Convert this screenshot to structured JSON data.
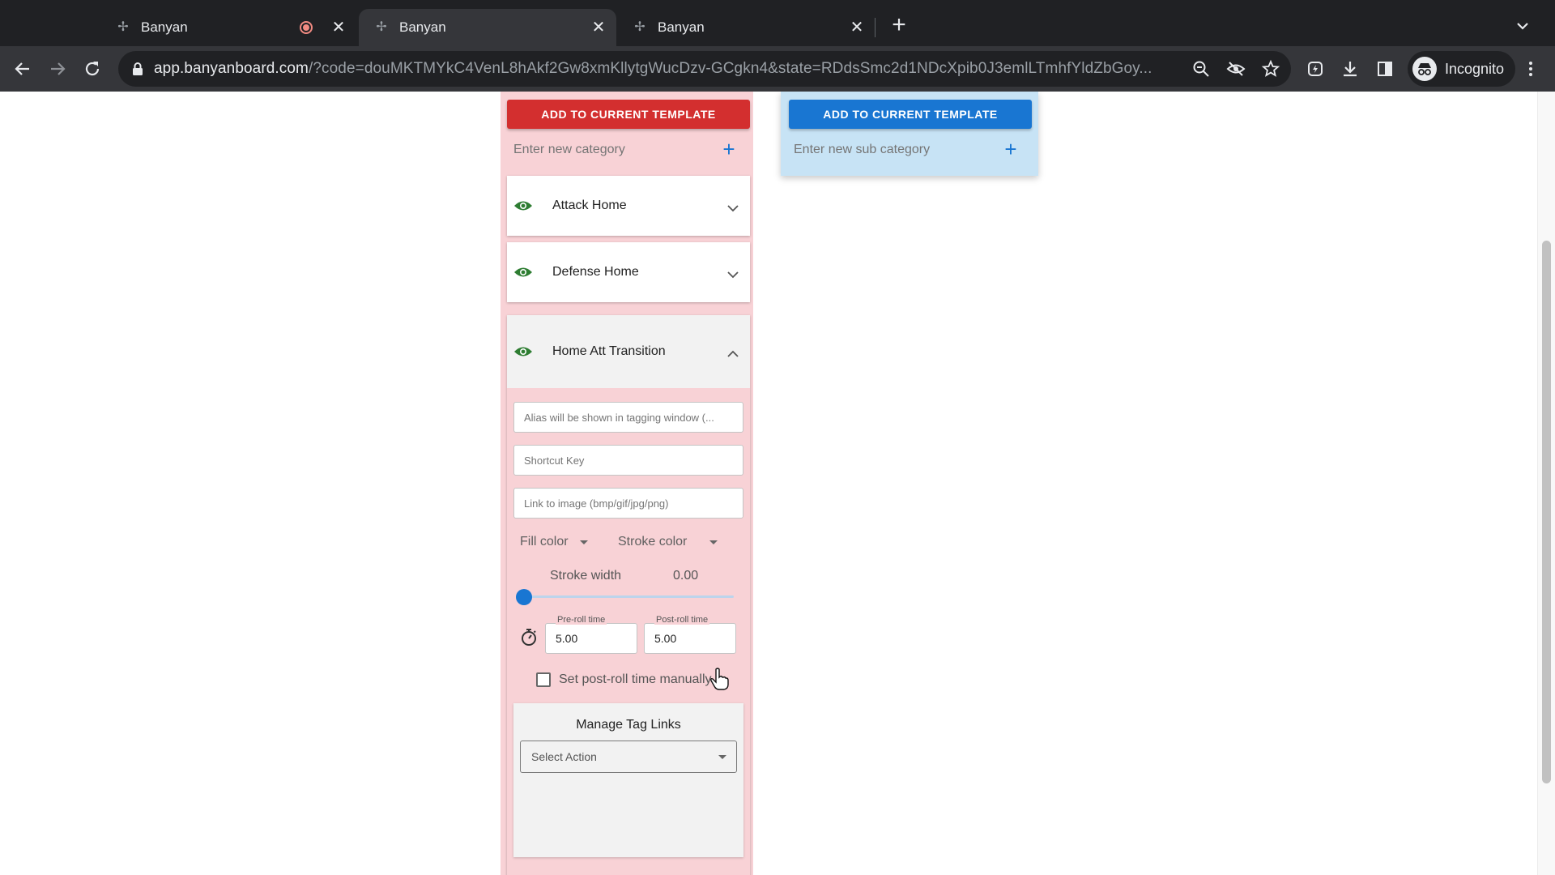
{
  "browser": {
    "tabs": [
      {
        "title": "Banyan",
        "recording": true,
        "active": false
      },
      {
        "title": "Banyan",
        "recording": false,
        "active": true
      },
      {
        "title": "Banyan",
        "recording": false,
        "active": false
      }
    ],
    "url_host": "app.banyanboard.com",
    "url_path": "/?code=douMKTMYkC4VenL8hAkf2Gw8xmKllytgWucDzv-GCgkn4&state=RDdsSmc2d1NDcXpib0J3emlLTmhfYldZbGoy...",
    "profile_label": "Incognito",
    "colors": {
      "tabstrip": "#202124",
      "toolbar": "#35363a",
      "omnibox": "#202124"
    }
  },
  "category_panel": {
    "add_button": "ADD TO CURRENT TEMPLATE",
    "new_placeholder": "Enter new category",
    "accent_color": "#d32f2f",
    "background": "#f8d2d6",
    "categories": [
      {
        "name": "Attack Home",
        "expanded": false
      },
      {
        "name": "Defense Home",
        "expanded": false
      },
      {
        "name": "Home Att Transition",
        "expanded": true
      }
    ],
    "editor": {
      "alias_placeholder": "Alias will be shown in tagging window (...",
      "shortcut_placeholder": "Shortcut Key",
      "image_link_placeholder": "Link to image (bmp/gif/jpg/png)",
      "fill_color_label": "Fill color",
      "stroke_color_label": "Stroke color",
      "stroke_width_label": "Stroke width",
      "stroke_width_value": "0.00",
      "stroke_width_fraction": 0,
      "pre_roll_label": "Pre-roll time",
      "pre_roll_value": "5.00",
      "post_roll_label": "Post-roll time",
      "post_roll_value": "5.00",
      "manual_post_roll_label": "Set post-roll time manually",
      "manual_post_roll_checked": false,
      "tag_links_title": "Manage Tag Links",
      "select_action_label": "Select Action"
    }
  },
  "subcategory_panel": {
    "add_button": "ADD TO CURRENT TEMPLATE",
    "new_placeholder": "Enter new sub category",
    "accent_color": "#1976d2",
    "background": "#c7e3f5"
  },
  "icons": {
    "visibility": "eye-icon",
    "timer": "stopwatch-icon",
    "add": "plus-icon",
    "expand": "chevron-down-icon",
    "collapse": "chevron-up-icon"
  }
}
